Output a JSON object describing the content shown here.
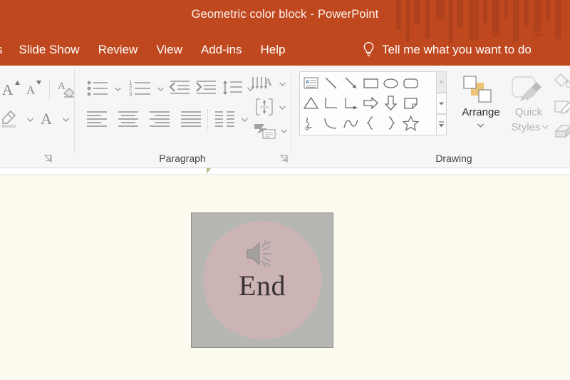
{
  "window": {
    "title_document": "Geometric color block",
    "title_separator": "-",
    "title_app": "PowerPoint",
    "accent_color": "#c0481f",
    "title_text_color": "#fdf3ee"
  },
  "ribbon_tabs": [
    {
      "label": "s",
      "name": "tab-clipped-transitions",
      "clipped": true
    },
    {
      "label": "Slide Show",
      "name": "tab-slide-show",
      "clipped": false
    },
    {
      "label": "Review",
      "name": "tab-review",
      "clipped": false
    },
    {
      "label": "View",
      "name": "tab-view",
      "clipped": false
    },
    {
      "label": "Add-ins",
      "name": "tab-add-ins",
      "clipped": false
    },
    {
      "label": "Help",
      "name": "tab-help",
      "clipped": false
    }
  ],
  "tell_me": {
    "icon": "lightbulb-icon",
    "label": "Tell me what you want to do"
  },
  "ribbon": {
    "font_group": {
      "label": "",
      "buttons": [
        {
          "name": "increase-font-size-button",
          "icon": "increase-font-size-icon"
        },
        {
          "name": "decrease-font-size-button",
          "icon": "decrease-font-size-icon"
        },
        {
          "name": "clear-formatting-button",
          "icon": "clear-formatting-icon"
        },
        {
          "name": "text-highlight-color-button",
          "icon": "text-highlight-color-icon"
        },
        {
          "name": "font-color-button",
          "icon": "font-color-icon"
        }
      ]
    },
    "paragraph_group": {
      "label": "Paragraph",
      "buttons": [
        {
          "name": "bullets-button",
          "icon": "bulleted-list-icon"
        },
        {
          "name": "numbering-button",
          "icon": "numbered-list-icon"
        },
        {
          "name": "decrease-indent-button",
          "icon": "decrease-indent-icon"
        },
        {
          "name": "increase-indent-button",
          "icon": "increase-indent-icon"
        },
        {
          "name": "line-spacing-button",
          "icon": "line-spacing-icon"
        },
        {
          "name": "align-left-button",
          "icon": "align-left-icon"
        },
        {
          "name": "align-center-button",
          "icon": "align-center-icon"
        },
        {
          "name": "align-right-button",
          "icon": "align-right-icon"
        },
        {
          "name": "justify-button",
          "icon": "justify-icon"
        },
        {
          "name": "columns-button",
          "icon": "columns-icon"
        },
        {
          "name": "text-direction-button",
          "icon": "text-direction-icon"
        },
        {
          "name": "align-text-button",
          "icon": "align-text-icon"
        },
        {
          "name": "convert-to-smartart-button",
          "icon": "smartart-icon"
        }
      ]
    },
    "drawing_group": {
      "label": "Drawing",
      "shapes": [
        {
          "name": "shape-text-box",
          "icon": "text-box-icon"
        },
        {
          "name": "shape-line",
          "icon": "line-icon"
        },
        {
          "name": "shape-line-arrow",
          "icon": "line-arrow-icon"
        },
        {
          "name": "shape-rectangle",
          "icon": "rectangle-icon"
        },
        {
          "name": "shape-oval",
          "icon": "oval-icon"
        },
        {
          "name": "shape-rounded-rectangle",
          "icon": "rounded-rectangle-icon"
        },
        {
          "name": "shape-triangle",
          "icon": "triangle-icon"
        },
        {
          "name": "shape-elbow-connector",
          "icon": "elbow-connector-icon"
        },
        {
          "name": "shape-elbow-arrow-connector",
          "icon": "elbow-arrow-connector-icon"
        },
        {
          "name": "shape-right-arrow",
          "icon": "right-arrow-icon"
        },
        {
          "name": "shape-down-arrow",
          "icon": "down-arrow-icon"
        },
        {
          "name": "shape-folded-corner",
          "icon": "folded-corner-icon"
        },
        {
          "name": "shape-scribble",
          "icon": "scribble-icon"
        },
        {
          "name": "shape-arc",
          "icon": "arc-icon"
        },
        {
          "name": "shape-curve",
          "icon": "curve-icon"
        },
        {
          "name": "shape-left-brace",
          "icon": "left-brace-icon"
        },
        {
          "name": "shape-right-brace",
          "icon": "right-brace-icon"
        },
        {
          "name": "shape-star",
          "icon": "star-icon"
        }
      ],
      "gallery_scroll": [
        {
          "name": "shapes-scroll-up-button",
          "icon": "chevron-up-icon",
          "disabled": true
        },
        {
          "name": "shapes-scroll-down-button",
          "icon": "chevron-down-icon",
          "disabled": false
        },
        {
          "name": "shapes-more-button",
          "icon": "more-chevron-icon",
          "disabled": false
        }
      ],
      "arrange": {
        "label": "Arrange",
        "icon": "arrange-icon",
        "disabled": false
      },
      "quick_styles": {
        "label_line1": "Quick",
        "label_line2": "Styles",
        "icon": "quick-styles-icon",
        "disabled": true
      },
      "format_buttons": [
        {
          "name": "shape-fill-button",
          "icon": "shape-fill-icon"
        },
        {
          "name": "shape-outline-button",
          "icon": "shape-outline-icon"
        },
        {
          "name": "shape-effects-button",
          "icon": "shape-effects-icon"
        }
      ]
    }
  },
  "slide": {
    "background_color": "#fdfaf0",
    "shape": {
      "name": "geometric-color-block",
      "square_color": "#b6b6b3",
      "circle_color": "#cdb4b4",
      "text": "End",
      "text_color": "#3a3132",
      "audio_icon": "speaker-audio-icon"
    }
  },
  "ruler": {
    "indent_marker_color": "#b8bd86"
  }
}
